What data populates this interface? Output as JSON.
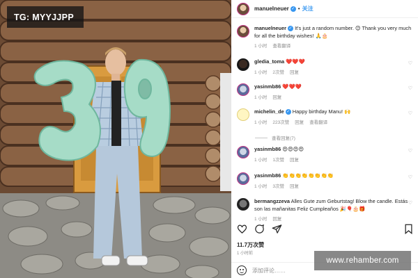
{
  "overlay": {
    "tg_label": "TG: MYYJJPP"
  },
  "photo": {
    "description_icon": "photo-icon",
    "balloon_digits": [
      "3",
      "9"
    ]
  },
  "post": {
    "author": "manuelneuer",
    "follow_label": "关注",
    "caption_user": "manuelneuer",
    "caption_text": " It's just a random number. 😊 Thank you very much for all the birthday wishes! 🙏🎂",
    "caption_time": "1 小时",
    "caption_translate": "查看翻译",
    "view_replies": "查看回复(7)",
    "likes": "11.7万次赞",
    "time_ago": "1 小时前",
    "add_comment_placeholder": "添加评论……"
  },
  "comments": [
    {
      "user": "gledia_toma",
      "text": " ❤️❤️❤️",
      "time": "1 小时",
      "likes": "2次赞",
      "reply": "回复"
    },
    {
      "user": "yasinmb86",
      "text": " ❤️❤️❤️",
      "time": "1 小时",
      "likes": "",
      "reply": "回复"
    },
    {
      "user": "michelin_de",
      "text": " Happy birthday Manu! 🙌",
      "time": "1 小时",
      "likes": "223次赞",
      "reply": "回复",
      "translate": "查看翻译"
    },
    {
      "user": "yasinmb86",
      "text": " 😍😍😍😍",
      "time": "1 小时",
      "likes": "1次赞",
      "reply": "回复"
    },
    {
      "user": "yasinmb86",
      "text": " 👏👏👏👏👏👏👏👏",
      "time": "1 小时",
      "likes": "3次赞",
      "reply": "回复"
    },
    {
      "user": "bermangzzeva",
      "text": " Alles Gute zum Geburtstag! Blow the candle. Estás son las mañanitas Feliz Cumpleaños 🎉🎈🎂🎁",
      "time": "1 小时",
      "likes": "",
      "reply": "回复"
    }
  ],
  "watermark": "www.rehamber.com",
  "colors": {
    "link_blue": "#3897f0",
    "heart_red": "#ed4956",
    "balloon": "#9ed6c2"
  }
}
